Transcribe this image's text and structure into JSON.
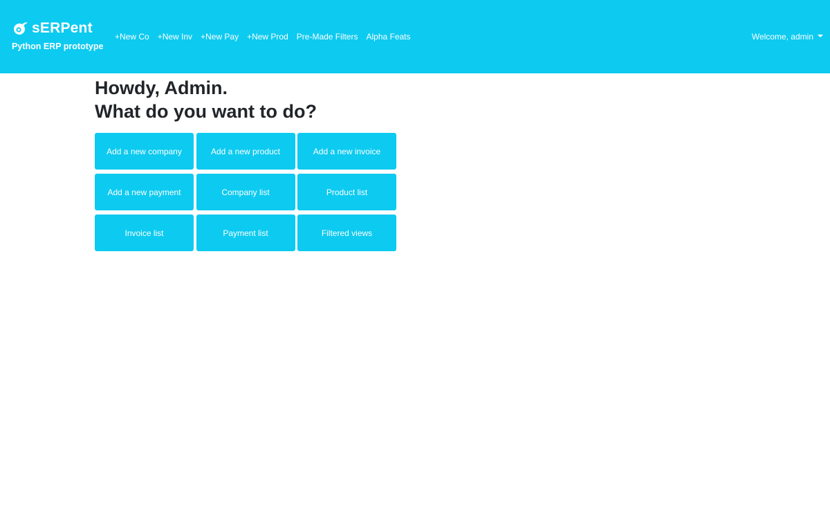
{
  "navbar": {
    "brand_name": "sERPent",
    "brand_subtitle": "Python ERP prototype",
    "brand_icon": "snake-eye-logo-icon",
    "links": [
      {
        "label": "+New Co"
      },
      {
        "label": "+New Inv"
      },
      {
        "label": "+New Pay"
      },
      {
        "label": "+New Prod"
      },
      {
        "label": "Pre-Made Filters"
      },
      {
        "label": "Alpha Feats"
      }
    ],
    "user_menu_label": "Welcome, admin",
    "user_menu_icon": "caret-down-icon",
    "background_color": "#0dcaf0"
  },
  "main": {
    "greeting": "Howdy, Admin.",
    "question": "What do you want to do?",
    "actions": [
      {
        "label": "Add a new company"
      },
      {
        "label": "Add a new product"
      },
      {
        "label": "Add a new invoice"
      },
      {
        "label": "Add a new payment"
      },
      {
        "label": "Company list"
      },
      {
        "label": "Product list"
      },
      {
        "label": "Invoice list"
      },
      {
        "label": "Payment list"
      },
      {
        "label": "Filtered views"
      }
    ],
    "button_color": "#0dcaf0"
  }
}
